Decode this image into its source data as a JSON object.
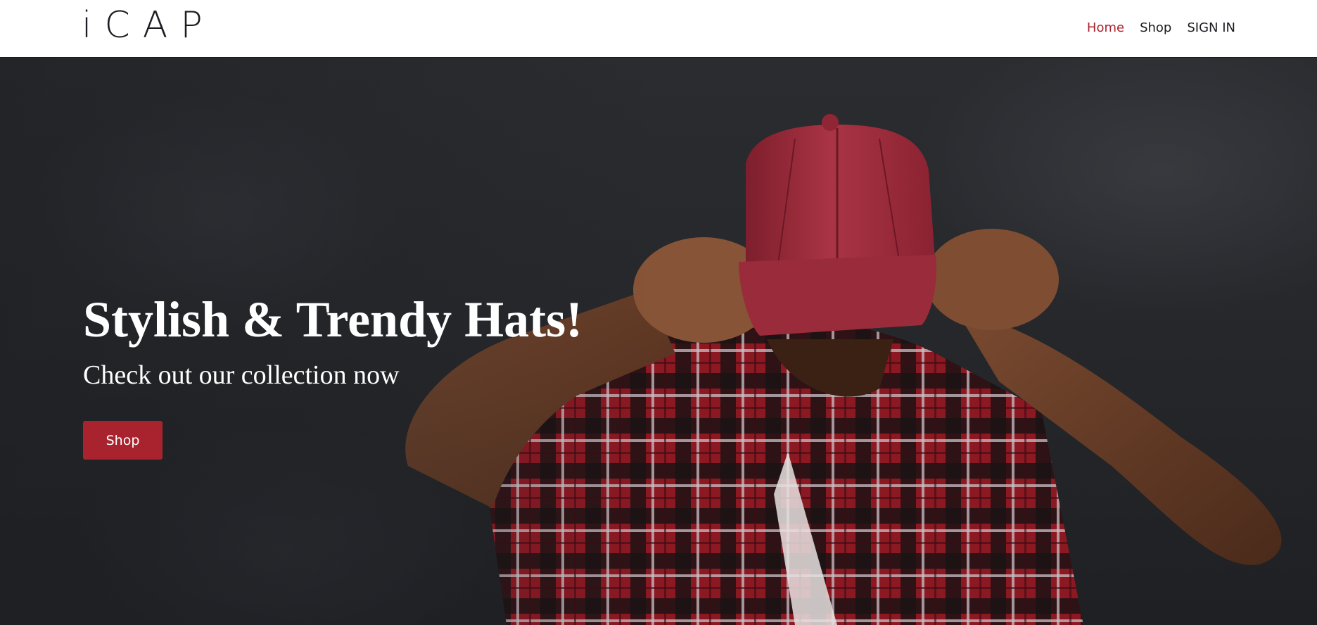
{
  "brand": {
    "logo_text": "iCAP"
  },
  "nav": {
    "items": [
      {
        "label": "Home",
        "active": true
      },
      {
        "label": "Shop",
        "active": false
      },
      {
        "label": "SIGN IN",
        "active": false
      }
    ]
  },
  "hero": {
    "title": "Stylish & Trendy Hats!",
    "subtitle": "Check out our collection now",
    "button_label": "Shop",
    "image": "man-in-red-cap-and-plaid-shirt-photo"
  },
  "colors": {
    "accent": "#a8232e",
    "nav_text": "#1b1b1f",
    "hero_text": "#ffffff",
    "hero_background": "#26282c"
  }
}
